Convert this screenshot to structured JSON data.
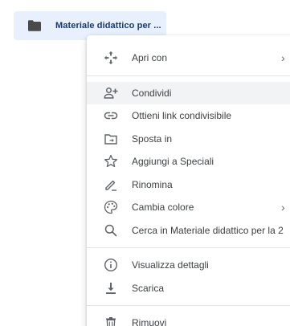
{
  "folder": {
    "label": "Materiale didattico per ..."
  },
  "menu": {
    "groups": [
      [
        {
          "label": "Apri con",
          "icon": "open-with-icon",
          "has_submenu": true
        }
      ],
      [
        {
          "label": "Condividi",
          "icon": "share-person-add-icon",
          "has_submenu": false,
          "highlighted": true
        },
        {
          "label": "Ottieni link condivisibile",
          "icon": "link-icon",
          "has_submenu": false
        },
        {
          "label": "Sposta in",
          "icon": "move-to-folder-icon",
          "has_submenu": false
        },
        {
          "label": "Aggiungi a Speciali",
          "icon": "star-icon",
          "has_submenu": false
        },
        {
          "label": "Rinomina",
          "icon": "pencil-icon",
          "has_submenu": false
        },
        {
          "label": "Cambia colore",
          "icon": "palette-icon",
          "has_submenu": true
        },
        {
          "label": "Cerca in Materiale didattico per la 2",
          "icon": "search-icon",
          "has_submenu": false
        }
      ],
      [
        {
          "label": "Visualizza dettagli",
          "icon": "info-icon",
          "has_submenu": false
        },
        {
          "label": "Scarica",
          "icon": "download-icon",
          "has_submenu": false
        }
      ],
      [
        {
          "label": "Rimuovi",
          "icon": "trash-icon",
          "has_submenu": false
        }
      ]
    ],
    "submenu_arrow": "›"
  },
  "colors": {
    "folder_chip_bg": "#e8f0fe",
    "folder_icon": "#4a4a4a",
    "menu_text": "#3c4043",
    "icon_gray": "#5f6368",
    "highlight_bg": "#f1f3f4"
  }
}
